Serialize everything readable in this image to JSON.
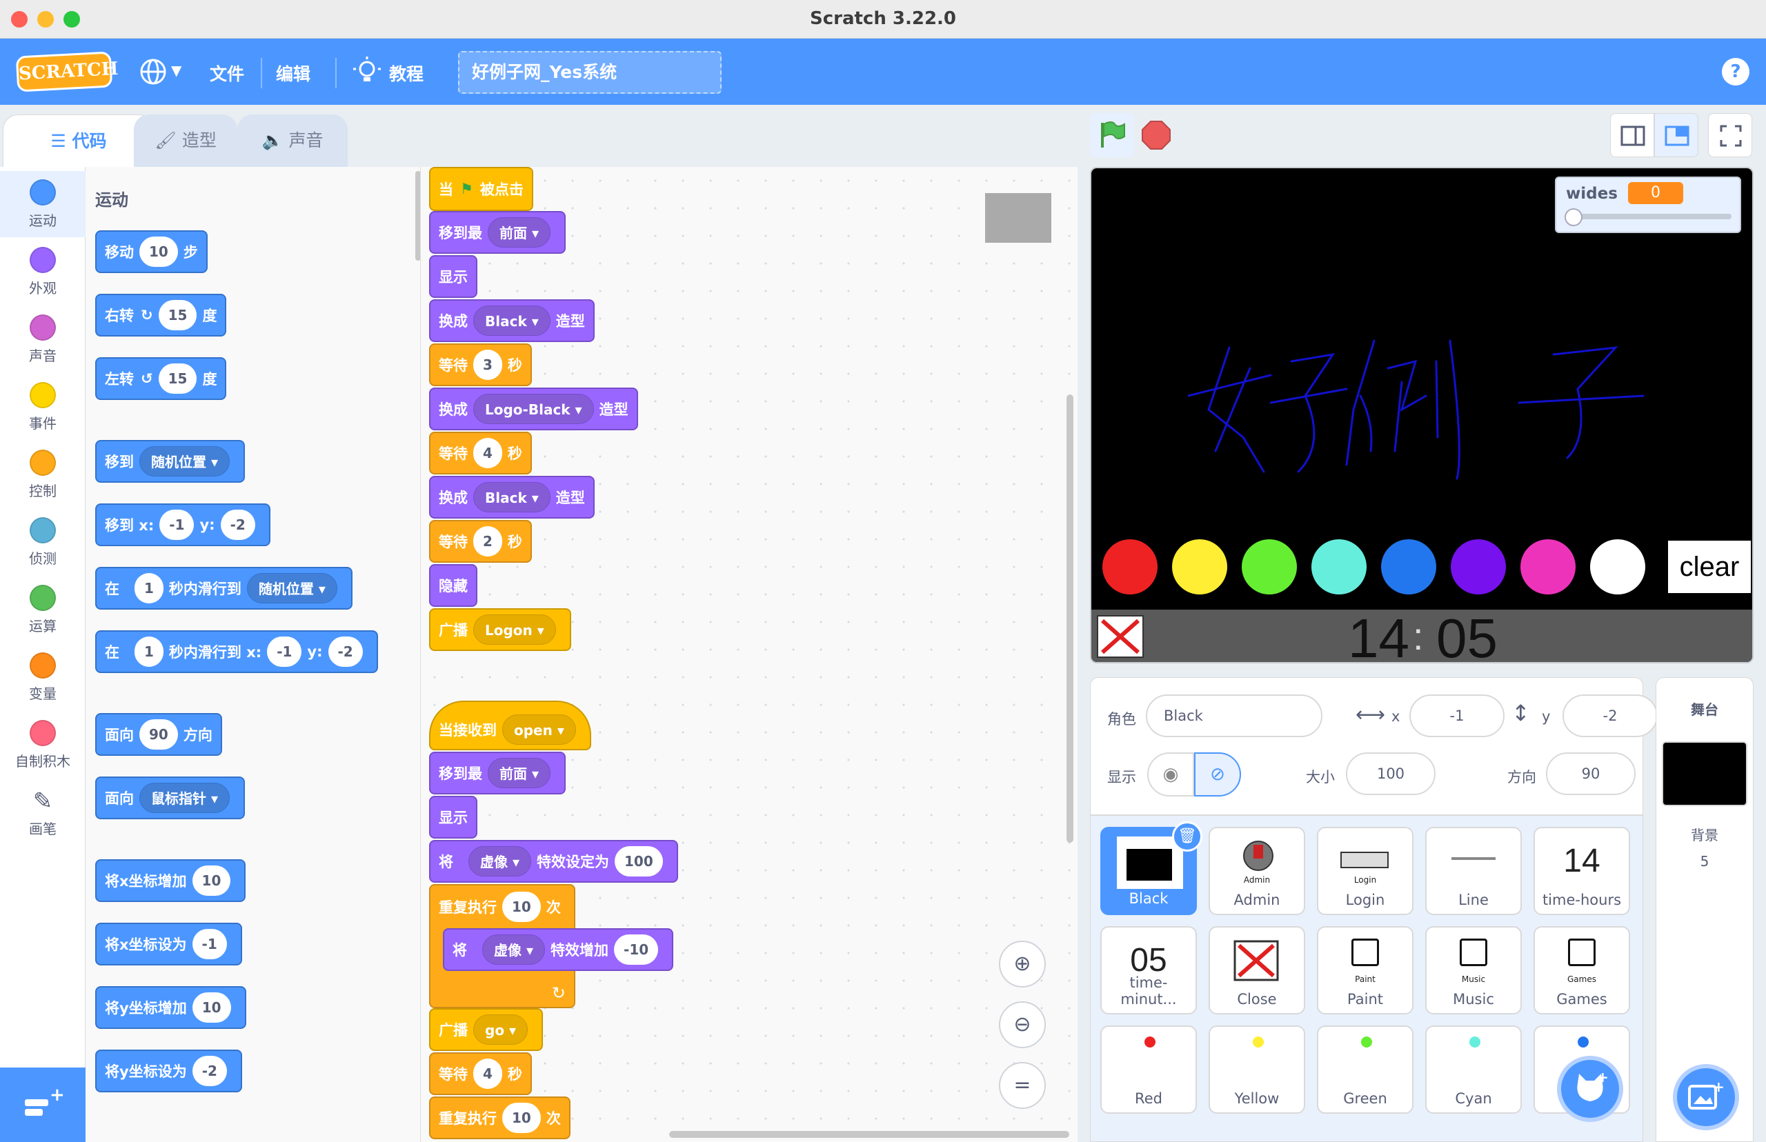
{
  "window": {
    "title": "Scratch 3.22.0"
  },
  "menubar": {
    "logo": "SCRATCH",
    "file": "文件",
    "edit": "编辑",
    "tutorials": "教程",
    "project_title": "好例子网_Yes系统",
    "help": "?"
  },
  "tabs": [
    {
      "label": "代码",
      "active": true
    },
    {
      "label": "造型"
    },
    {
      "label": "声音"
    }
  ],
  "categories": [
    {
      "label": "运动",
      "color": "#4c97ff"
    },
    {
      "label": "外观",
      "color": "#9966ff"
    },
    {
      "label": "声音",
      "color": "#cf63cf"
    },
    {
      "label": "事件",
      "color": "#ffd500"
    },
    {
      "label": "控制",
      "color": "#ffab19"
    },
    {
      "label": "侦测",
      "color": "#5cb1d6"
    },
    {
      "label": "运算",
      "color": "#59c059"
    },
    {
      "label": "变量",
      "color": "#ff8c1a"
    },
    {
      "label": "自制积木",
      "color": "#ff6680"
    },
    {
      "label": "画笔",
      "color": "#0fbd8c"
    }
  ],
  "palette": {
    "heading": "运动",
    "move": {
      "a": "移动",
      "n": "10",
      "b": "步"
    },
    "turn_right": {
      "a": "右转",
      "n": "15",
      "b": "度"
    },
    "turn_left": {
      "a": "左转",
      "n": "15",
      "b": "度"
    },
    "goto": {
      "a": "移到",
      "dd": "随机位置"
    },
    "goto_xy": {
      "a": "移到 x:",
      "x": "-1",
      "yl": "y:",
      "y": "-2"
    },
    "glide": {
      "a": "在",
      "n": "1",
      "b": "秒内滑行到",
      "dd": "随机位置"
    },
    "glide_xy": {
      "a": "在",
      "n": "1",
      "b": "秒内滑行到 x:",
      "x": "-1",
      "yl": "y:",
      "y": "-2"
    },
    "point": {
      "a": "面向",
      "n": "90",
      "b": "方向"
    },
    "point_to": {
      "a": "面向",
      "dd": "鼠标指针"
    },
    "change_x": {
      "a": "将x坐标增加",
      "n": "10"
    },
    "set_x": {
      "a": "将x坐标设为",
      "n": "-1"
    },
    "change_y": {
      "a": "将y坐标增加",
      "n": "10"
    },
    "set_y": {
      "a": "将y坐标设为",
      "n": "-2"
    }
  },
  "script1": {
    "hat": {
      "a": "当",
      "b": "被点击"
    },
    "front1": {
      "a": "移到最",
      "dd": "前面"
    },
    "show1": "显示",
    "costume1": {
      "a": "换成",
      "dd": "Black",
      "b": "造型"
    },
    "wait1": {
      "a": "等待",
      "n": "3",
      "b": "秒"
    },
    "costume2": {
      "a": "换成",
      "dd": "Logo-Black",
      "b": "造型"
    },
    "wait2": {
      "a": "等待",
      "n": "4",
      "b": "秒"
    },
    "costume3": {
      "a": "换成",
      "dd": "Black",
      "b": "造型"
    },
    "wait3": {
      "a": "等待",
      "n": "2",
      "b": "秒"
    },
    "hide": "隐藏",
    "broadcast": {
      "a": "广播",
      "dd": "Logon"
    }
  },
  "script2": {
    "hat": {
      "a": "当接收到",
      "dd": "open"
    },
    "front": {
      "a": "移到最",
      "dd": "前面"
    },
    "show": "显示",
    "seteffect": {
      "a": "将",
      "dd": "虚像",
      "b": "特效设定为",
      "n": "100"
    },
    "repeat1": {
      "a": "重复执行",
      "n": "10",
      "b": "次"
    },
    "changeeffect": {
      "a": "将",
      "dd": "虚像",
      "b": "特效增加",
      "n": "-10"
    },
    "broadcast": {
      "a": "广播",
      "dd": "go"
    },
    "wait": {
      "a": "等待",
      "n": "4",
      "b": "秒"
    },
    "repeat2": {
      "a": "重复执行",
      "n": "10",
      "b": "次"
    }
  },
  "stage": {
    "monitor_label": "wides",
    "monitor_value": "0",
    "clear_label": "clear",
    "clock_hours": "14",
    "clock_sep": ":",
    "clock_minutes": "05",
    "color_buttons": [
      "#ee2222",
      "#ffee33",
      "#66ee33",
      "#66eedd",
      "#2277ee",
      "#7711ee",
      "#ee33bb",
      "#ffffff"
    ]
  },
  "sprite_info": {
    "sprite_label": "角色",
    "sprite_name": "Black",
    "x_label": "x",
    "x": "-1",
    "y_label": "y",
    "y": "-2",
    "show_label": "显示",
    "size_label": "大小",
    "size": "100",
    "direction_label": "方向",
    "direction": "90"
  },
  "sprites": [
    {
      "name": "Black",
      "selected": true
    },
    {
      "name": "Admin",
      "caption": "Admin"
    },
    {
      "name": "Login",
      "caption": "Login"
    },
    {
      "name": "Line"
    },
    {
      "name": "time-hours",
      "big": "14"
    },
    {
      "name": "time-minut...",
      "big": "05"
    },
    {
      "name": "Close"
    },
    {
      "name": "Paint",
      "caption": "Paint"
    },
    {
      "name": "Music",
      "caption": "Music"
    },
    {
      "name": "Games",
      "caption": "Games"
    },
    {
      "name": "Red",
      "dot": "#ee2222"
    },
    {
      "name": "Yellow",
      "dot": "#ffee33"
    },
    {
      "name": "Green",
      "dot": "#66ee33"
    },
    {
      "name": "Cyan",
      "dot": "#66eedd"
    },
    {
      "name": "",
      "dot": "#2277ee"
    }
  ],
  "stage_pane": {
    "title": "舞台",
    "backdrops_label": "背景",
    "backdrops_count": "5"
  }
}
